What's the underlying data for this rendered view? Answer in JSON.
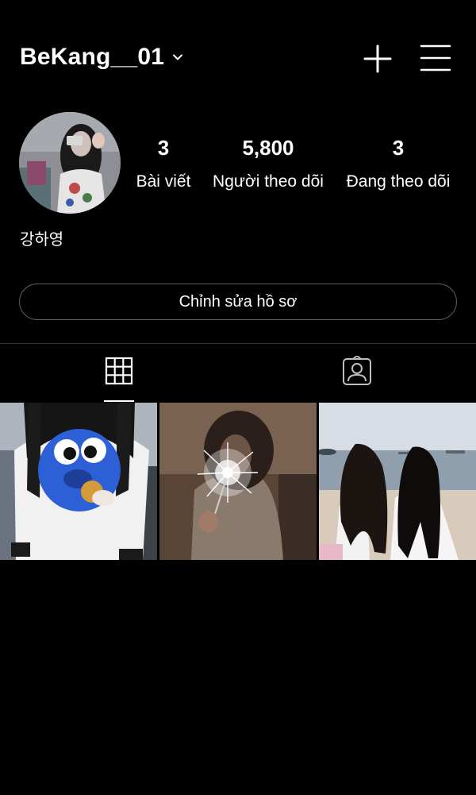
{
  "header": {
    "username": "BeKang__01",
    "icons": {
      "dropdown": "chevron-down-icon",
      "create": "plus-icon",
      "menu": "hamburger-menu-icon"
    }
  },
  "profile": {
    "display_name": "강하영",
    "stats": {
      "posts": {
        "count": "3",
        "label": "Bài viết"
      },
      "followers": {
        "count": "5,800",
        "label": "Người theo dõi"
      },
      "following": {
        "count": "3",
        "label": "Đang theo dõi"
      }
    },
    "edit_button_label": "Chỉnh sửa hồ sơ"
  },
  "tabs": [
    {
      "icon": "grid-icon",
      "active": true
    },
    {
      "icon": "tagged-person-icon",
      "active": false
    }
  ],
  "posts_count_shown": 3
}
